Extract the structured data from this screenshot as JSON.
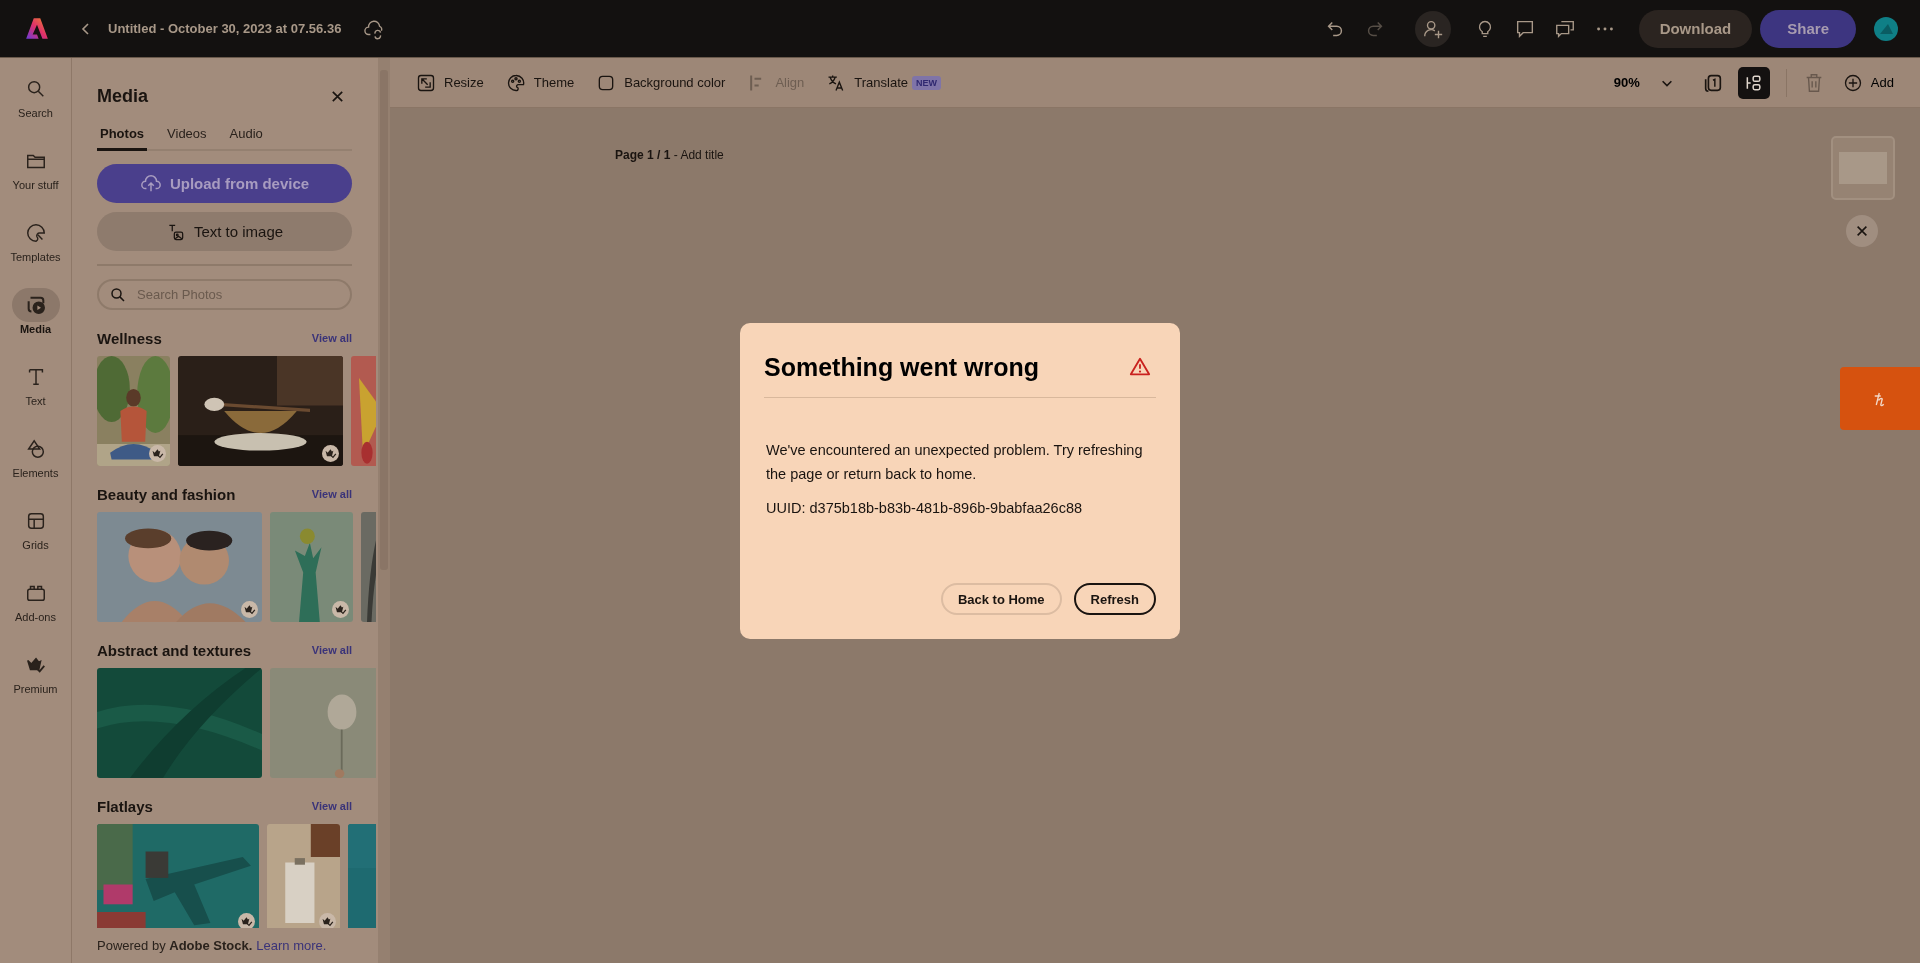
{
  "topbar": {
    "title": "Untitled - October 30, 2023 at 07.56.36",
    "redo": {
      "disabled": true
    },
    "download": "Download",
    "share": "Share"
  },
  "rail": [
    {
      "label": "Search",
      "selected": false
    },
    {
      "label": "Your stuff",
      "selected": false
    },
    {
      "label": "Templates",
      "selected": false
    },
    {
      "label": "Media",
      "selected": true
    },
    {
      "label": "Text",
      "selected": false
    },
    {
      "label": "Elements",
      "selected": false
    },
    {
      "label": "Grids",
      "selected": false
    },
    {
      "label": "Add-ons",
      "selected": false
    },
    {
      "label": "Premium",
      "selected": false
    }
  ],
  "media_panel": {
    "title": "Media",
    "tabs": [
      {
        "label": "Photos",
        "selected": true
      },
      {
        "label": "Videos",
        "selected": false
      },
      {
        "label": "Audio",
        "selected": false
      }
    ],
    "upload": "Upload from device",
    "text_to_image": "Text to image",
    "search": {
      "placeholder": "Search Photos"
    },
    "sections": [
      {
        "title": "Wellness",
        "link": "View all",
        "thumbs": [
          {
            "kind": "picture",
            "premium": true
          },
          {
            "kind": "picture",
            "premium": true
          },
          {
            "kind": "picture",
            "premium": false
          }
        ]
      },
      {
        "title": "Beauty and fashion",
        "link": "View all",
        "thumbs": [
          {
            "kind": "picture",
            "premium": true
          },
          {
            "kind": "picture",
            "premium": true
          },
          {
            "kind": "picture",
            "premium": false
          }
        ]
      },
      {
        "title": "Abstract and textures",
        "link": "View all",
        "thumbs": [
          {
            "kind": "picture",
            "premium": false
          },
          {
            "kind": "picture",
            "premium": false
          }
        ]
      },
      {
        "title": "Flatlays",
        "link": "View all",
        "thumbs": [
          {
            "kind": "picture",
            "premium": true
          },
          {
            "kind": "picture",
            "premium": true
          },
          {
            "kind": "picture",
            "premium": false
          }
        ]
      }
    ],
    "footer": {
      "text": "Powered by **Adobe Stock.**",
      "link": "Learn more."
    }
  },
  "toolbar": {
    "items": [
      {
        "label": "Resize",
        "disabled": false
      },
      {
        "label": "Theme",
        "disabled": false
      },
      {
        "label": "Background color",
        "disabled": false
      },
      {
        "label": "Align",
        "disabled": true
      },
      {
        "label": "Translate",
        "disabled": false,
        "badge": "NEW"
      }
    ],
    "zoom": "90%",
    "trash": {
      "disabled": true
    },
    "add": "Add"
  },
  "canvas": {
    "page_label": "**Page 1 / 1** - Add title"
  },
  "dialog": {
    "title": "Something went wrong",
    "message": "We've encountered an unexpected problem. Try refreshing the page or return back to home.",
    "uuid": "UUID: d375b18b-b83b-481b-896b-9babfaa26c88",
    "buttons": [
      {
        "label": "Back to Home",
        "kind": "secondary"
      },
      {
        "label": "Refresh",
        "kind": "primary"
      }
    ]
  }
}
